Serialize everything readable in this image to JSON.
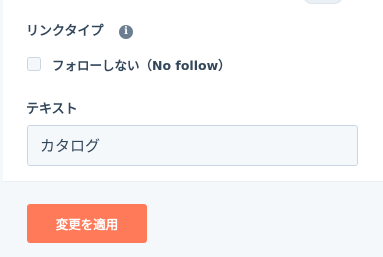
{
  "link_type": {
    "label": "リンクタイプ",
    "info_icon": "info-icon",
    "nofollow_checkbox": {
      "label": "フォローしない（No follow）",
      "checked": false
    }
  },
  "text_field": {
    "label": "テキスト",
    "value": "カタログ"
  },
  "footer": {
    "apply_button_label": "変更を適用",
    "apply_button_color": "#ff7a59"
  }
}
